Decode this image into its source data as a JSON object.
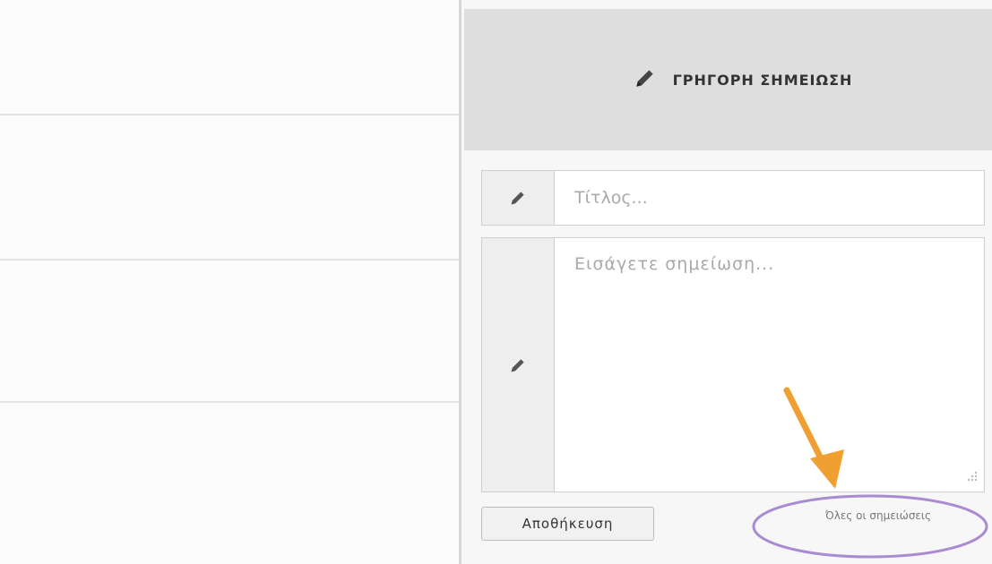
{
  "quick_note": {
    "title": "ΓΡΗΓΟΡΗ ΣΗΜΕΙΩΣΗ",
    "header_icon": "pencil-icon",
    "title_field": {
      "placeholder": "Τίτλος...",
      "value": "",
      "icon": "pencil-icon"
    },
    "note_field": {
      "placeholder": "Εισάγετε σημείωση...",
      "value": "",
      "icon": "pencil-icon"
    },
    "save_label": "Αποθήκευση",
    "all_notes_label": "Όλες οι σημειώσεις"
  },
  "annotation": {
    "arrow_color": "#f0a030",
    "ellipse_color": "#a98bd1"
  }
}
